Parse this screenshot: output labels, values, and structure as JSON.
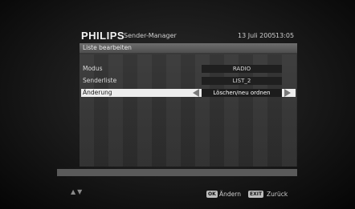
{
  "header": {
    "brand": "PHILIPS",
    "title": "Sender-Manager",
    "date": "13 Juli 2005",
    "time": "13:05"
  },
  "subheader": "Liste bearbeiten",
  "rows": [
    {
      "label": "Modus",
      "value": "RADIO"
    },
    {
      "label": "Senderliste",
      "value": "LIST_2"
    },
    {
      "label": "Änderung",
      "value": "Löschen/neu ordnen"
    }
  ],
  "selected_row": 2,
  "footer": {
    "nav": "▲▼",
    "ok_key": "OK",
    "ok_label": "Ändern",
    "exit_key": "EXIT",
    "exit_label": "Zurück"
  },
  "colors": {
    "background": "#1e1e1e",
    "highlight": "#ededed",
    "panel": "#333333"
  }
}
